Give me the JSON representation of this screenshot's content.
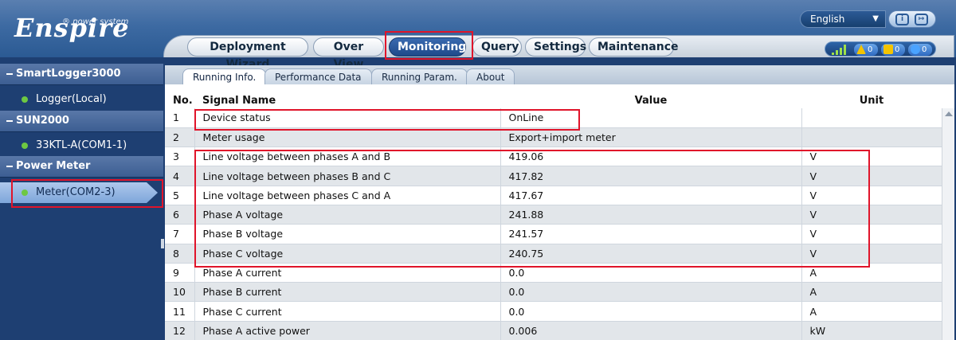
{
  "header": {
    "logo_text": "Enspire",
    "logo_subtitle": "power system",
    "language": "English",
    "nav_tabs": [
      {
        "label": "Deployment Wizard"
      },
      {
        "label": "Over View"
      },
      {
        "label": "Monitoring"
      },
      {
        "label": "Query"
      },
      {
        "label": "Settings"
      },
      {
        "label": "Maintenance"
      }
    ],
    "active_tab": "Monitoring",
    "alarms": {
      "major": "0",
      "minor": "0",
      "warning": "0"
    },
    "colors": {
      "major": "#f4c400",
      "minor": "#f4c400",
      "warning": "#4aa3ff",
      "active_tab": "#1e4a8a"
    }
  },
  "sidebar": {
    "groups": [
      {
        "label": "SmartLogger3000",
        "items": [
          {
            "label": "Logger(Local)"
          }
        ]
      },
      {
        "label": "SUN2000",
        "items": [
          {
            "label": "33KTL-A(COM1-1)"
          }
        ]
      },
      {
        "label": "Power Meter",
        "items": [
          {
            "label": "Meter(COM2-3)"
          }
        ]
      }
    ],
    "selected": "Meter(COM2-3)"
  },
  "subtabs": [
    {
      "label": "Running Info."
    },
    {
      "label": "Performance Data"
    },
    {
      "label": "Running Param."
    },
    {
      "label": "About"
    }
  ],
  "table": {
    "headers": {
      "no": "No.",
      "signal": "Signal Name",
      "value": "Value",
      "unit": "Unit"
    },
    "rows": [
      {
        "no": "1",
        "signal": "Device status",
        "value": "OnLine",
        "unit": ""
      },
      {
        "no": "2",
        "signal": "Meter usage",
        "value": "Export+import meter",
        "unit": ""
      },
      {
        "no": "3",
        "signal": "Line voltage between phases A and B",
        "value": "419.06",
        "unit": "V"
      },
      {
        "no": "4",
        "signal": "Line voltage between phases B and C",
        "value": "417.82",
        "unit": "V"
      },
      {
        "no": "5",
        "signal": "Line voltage between phases C and A",
        "value": "417.67",
        "unit": "V"
      },
      {
        "no": "6",
        "signal": "Phase A voltage",
        "value": "241.88",
        "unit": "V"
      },
      {
        "no": "7",
        "signal": "Phase B voltage",
        "value": "241.57",
        "unit": "V"
      },
      {
        "no": "8",
        "signal": "Phase C voltage",
        "value": "240.75",
        "unit": "V"
      },
      {
        "no": "9",
        "signal": "Phase A current",
        "value": "0.0",
        "unit": "A"
      },
      {
        "no": "10",
        "signal": "Phase B current",
        "value": "0.0",
        "unit": "A"
      },
      {
        "no": "11",
        "signal": "Phase C current",
        "value": "0.0",
        "unit": "A"
      },
      {
        "no": "12",
        "signal": "Phase A active power",
        "value": "0.006",
        "unit": "kW"
      }
    ]
  },
  "highlight_color": "#e0142a"
}
